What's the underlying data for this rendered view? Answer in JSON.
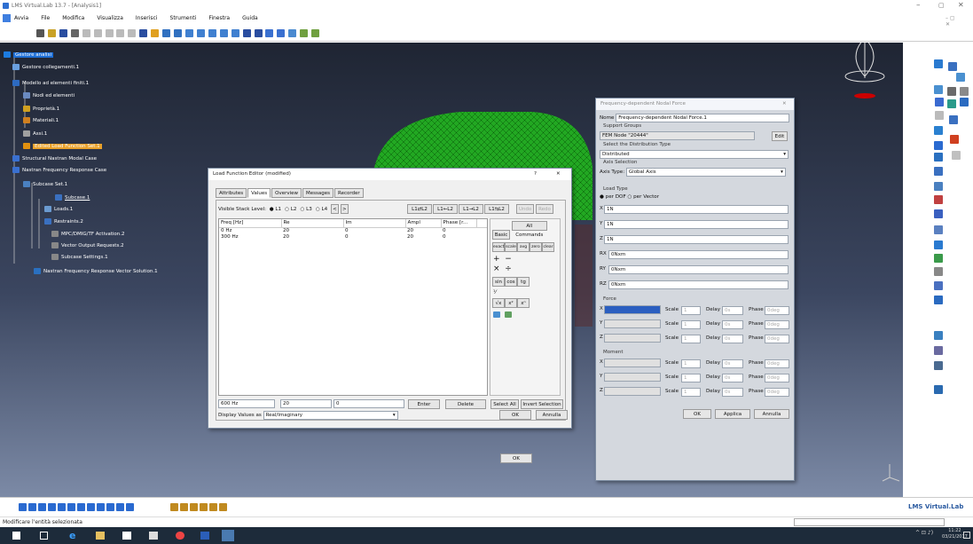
{
  "app": {
    "title": "LMS Virtual.Lab 13.7 - [Analysis1]",
    "brand": "LMS Virtual.Lab",
    "clock_time": "11:22",
    "clock_date": "03/21/2017"
  },
  "menu": [
    "Avvia",
    "File",
    "Modifica",
    "Visualizza",
    "Inserisci",
    "Strumenti",
    "Finestra",
    "Guida"
  ],
  "tree": {
    "root": "Gestore analisi",
    "items": [
      "Gestore collegamenti.1",
      "Modello ad elementi finiti.1",
      "Nodi ed elementi",
      "Proprietà.1",
      "Materiali.1",
      "Assi.1",
      "Edited Load Function Set.1",
      "Structural Nastran Modal Case",
      "Nastran Frequency Response Case",
      "Subcase Set.1",
      "Subcase.1",
      "Loads.1",
      "Restraints.2",
      "MPC/DMIG/TF Activation.2",
      "Vector Output Requests.2",
      "Subcase Settings.1",
      "Nastran Frequency Response Vector Solution.1"
    ]
  },
  "status_text": "Modificare l'entità selezionata",
  "lfe": {
    "title": "Load Function Editor (modified)",
    "title_help": "?",
    "close": "✕",
    "tabs": [
      "Attributes",
      "Values",
      "Overview",
      "Messages",
      "Recorder"
    ],
    "stack_label": "Visible Stack Level:",
    "levels": [
      "L1",
      "L2",
      "L3",
      "L4"
    ],
    "nav": [
      "<",
      ">"
    ],
    "stack_ops": [
      "L1⇄L2",
      "L1←L2",
      "L1→L2",
      "L1⇆L2"
    ],
    "undo": "Undo",
    "redo": "Redo",
    "columns": [
      "Freq [Hz]",
      "Re",
      "Im",
      "Ampl",
      "Phase [r..."
    ],
    "rows": [
      [
        "0 Hz",
        "20",
        "0",
        "20",
        "0"
      ],
      [
        "300 Hz",
        "20",
        "0",
        "20",
        "0"
      ]
    ],
    "cmd_tabs": [
      "Basic",
      "All Commands"
    ],
    "cmd_row1": [
      "exact",
      "scale",
      "avg",
      "zero",
      "clear"
    ],
    "ops": [
      "+",
      "−",
      "×",
      "÷"
    ],
    "trig": [
      "sin",
      "cos",
      "tg"
    ],
    "pow": [
      "√x",
      "x²",
      "xⁿ"
    ],
    "edit": {
      "freq": "600 Hz",
      "re": "20",
      "im": "0"
    },
    "enter": "Enter",
    "delete": "Delete",
    "select_all": "Select All",
    "invert": "Invert Selection",
    "display_label": "Display Values as",
    "display_value": "Real/Imaginary",
    "ok": "OK",
    "cancel": "Annulla"
  },
  "fdnf": {
    "title": "Frequency-dependent Nodal Force",
    "name_label": "Nome",
    "name_value": "Frequency-dependent Nodal Force.1",
    "support_groups": "Support Groups",
    "support_value": "FEM Node \"20444\"",
    "edit": "Edit",
    "dist_type_label": "Select the Distribution Type",
    "dist_value": "Distributed",
    "axis_sel": "Axis Selection",
    "axis_type_label": "Axis Type:",
    "axis_value": "Global Axis",
    "load_type": "Load Type",
    "per_dof": "per DOF",
    "per_vector": "per Vector",
    "dofs": [
      {
        "label": "X",
        "value": "1N"
      },
      {
        "label": "Y",
        "value": "1N"
      },
      {
        "label": "Z",
        "value": "1N"
      },
      {
        "label": "RX",
        "value": "0Nxm"
      },
      {
        "label": "RY",
        "value": "0Nxm"
      },
      {
        "label": "RZ",
        "value": "0Nxm"
      }
    ],
    "force": "Force",
    "moment": "Moment",
    "axes": [
      "X",
      "Y",
      "Z"
    ],
    "scale_label": "Scale",
    "scale_value": "1",
    "delay_label": "Delay",
    "delay_value": "0s",
    "phase_label": "Phase",
    "phase_value": "0deg",
    "ok": "OK",
    "apply": "Applica",
    "cancel": "Annulla"
  }
}
